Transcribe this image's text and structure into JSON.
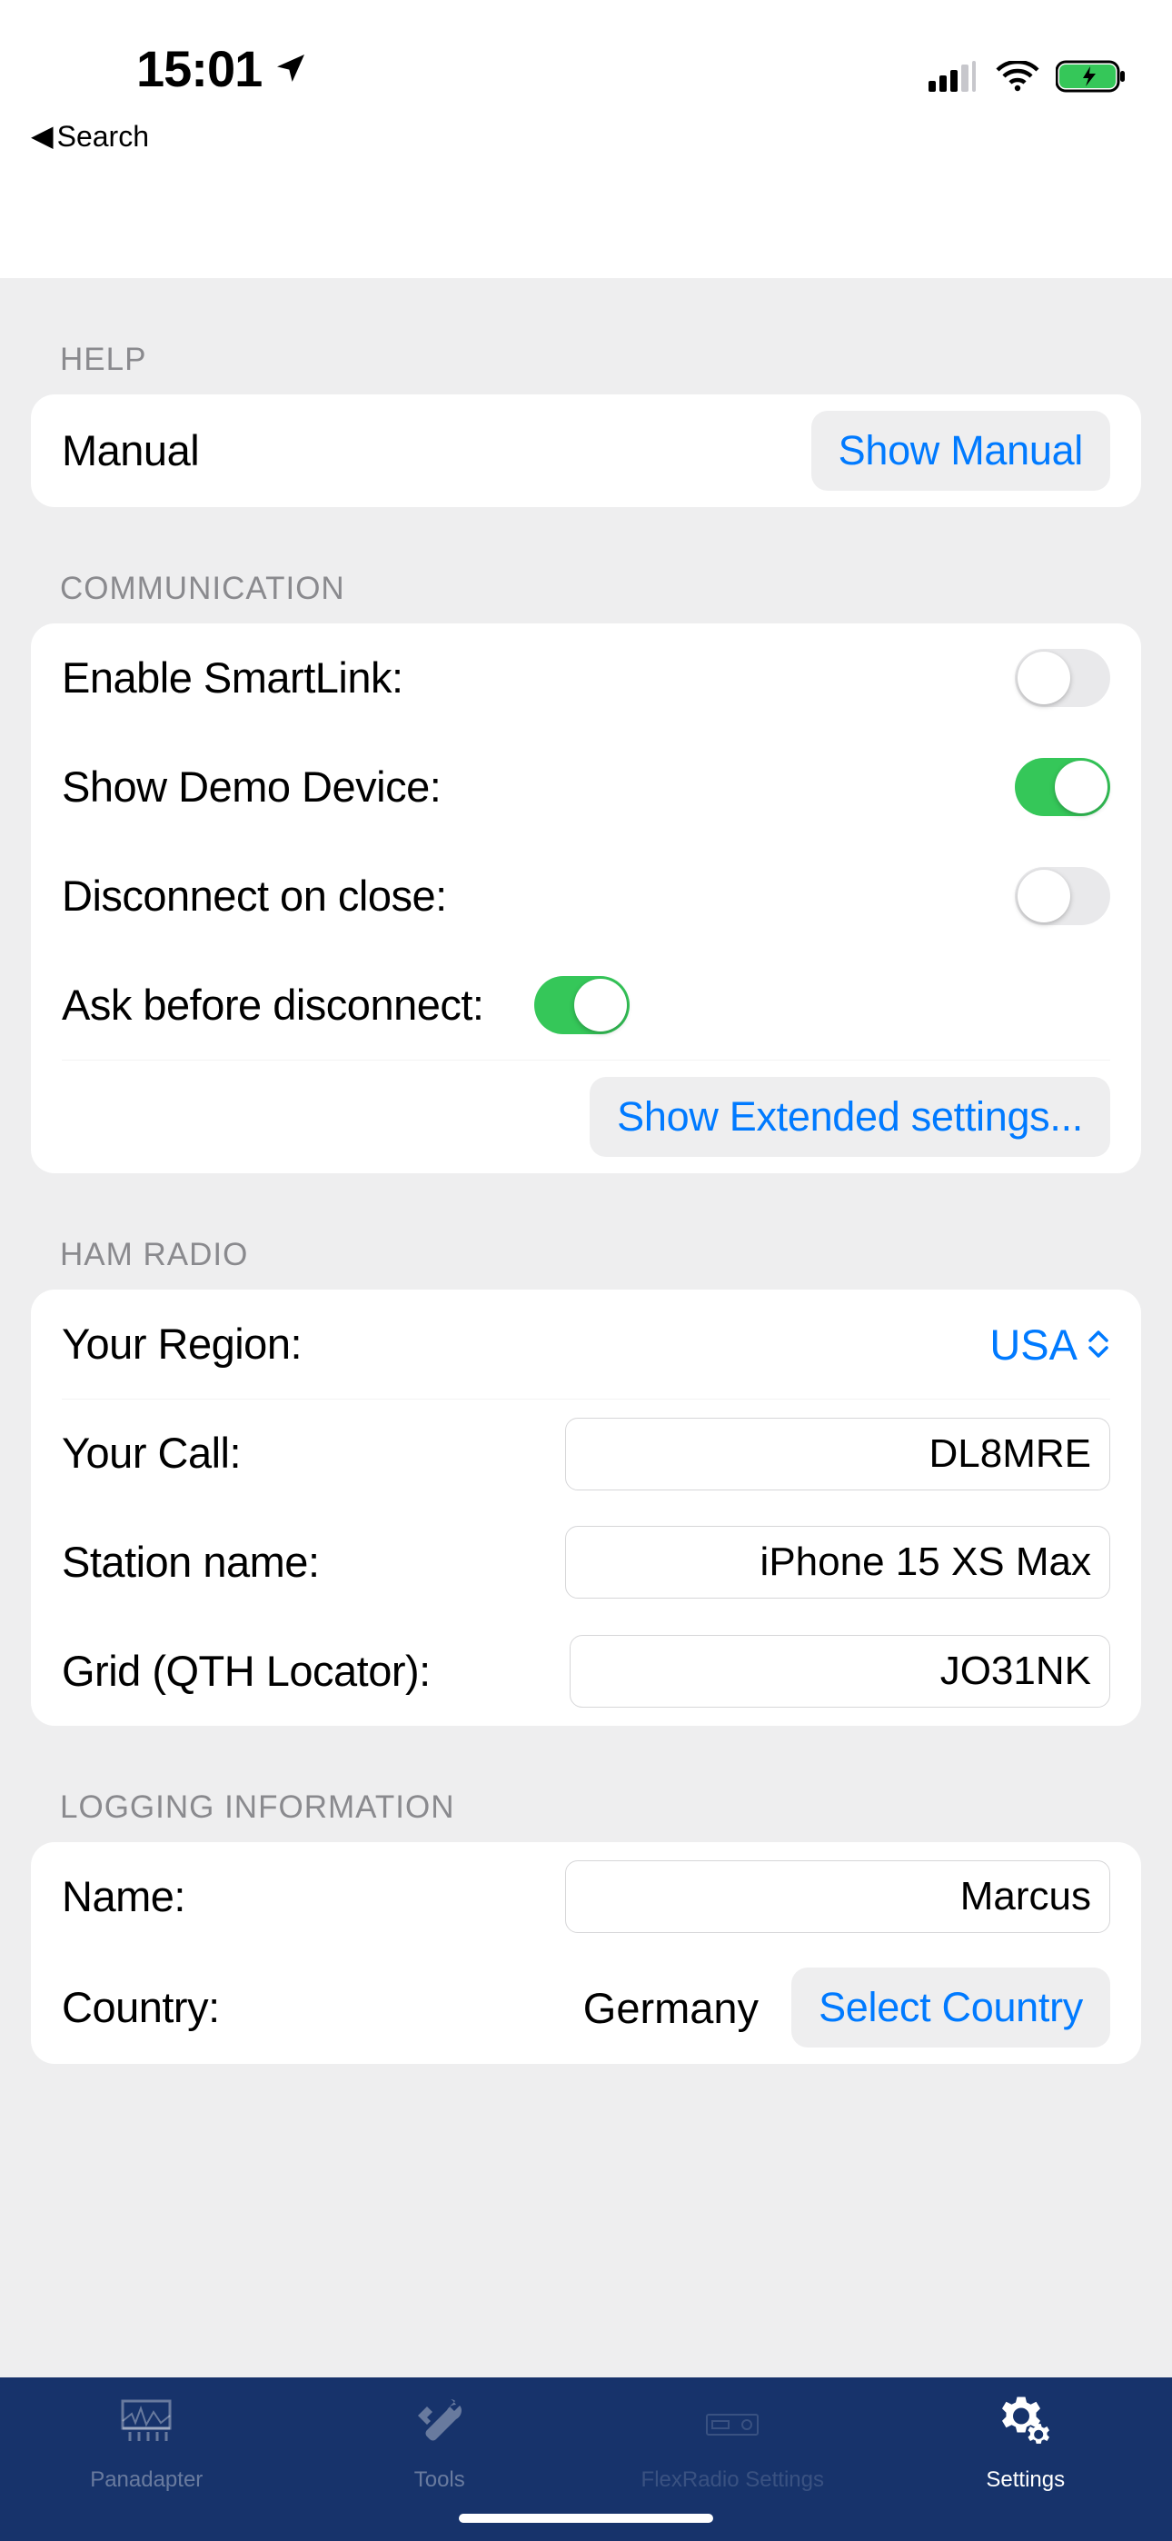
{
  "status_bar": {
    "time": "15:01",
    "back_label": "Search"
  },
  "sections": {
    "help": {
      "header": "HELP",
      "manual_label": "Manual",
      "show_manual_button": "Show Manual"
    },
    "communication": {
      "header": "COMMUNICATION",
      "enable_smartlink": {
        "label": "Enable SmartLink:",
        "value": false
      },
      "show_demo_device": {
        "label": "Show Demo Device:",
        "value": true
      },
      "disconnect_on_close": {
        "label": "Disconnect on close:",
        "value": false
      },
      "ask_before_disconnect": {
        "label": "Ask before disconnect:",
        "value": true
      },
      "show_extended_button": "Show Extended settings..."
    },
    "ham_radio": {
      "header": "HAM RADIO",
      "region_label": "Your Region:",
      "region_value": "USA",
      "call_label": "Your Call:",
      "call_value": "DL8MRE",
      "station_label": "Station name:",
      "station_value": "iPhone 15 XS Max",
      "grid_label": "Grid (QTH Locator):",
      "grid_value": "JO31NK"
    },
    "logging": {
      "header": "LOGGING INFORMATION",
      "name_label": "Name:",
      "name_value": "Marcus",
      "country_label": "Country:",
      "country_value": "Germany",
      "select_country_button": "Select Country"
    }
  },
  "tabbar": {
    "panadapter": "Panadapter",
    "tools": "Tools",
    "flexradio": "FlexRadio Settings",
    "settings": "Settings"
  }
}
